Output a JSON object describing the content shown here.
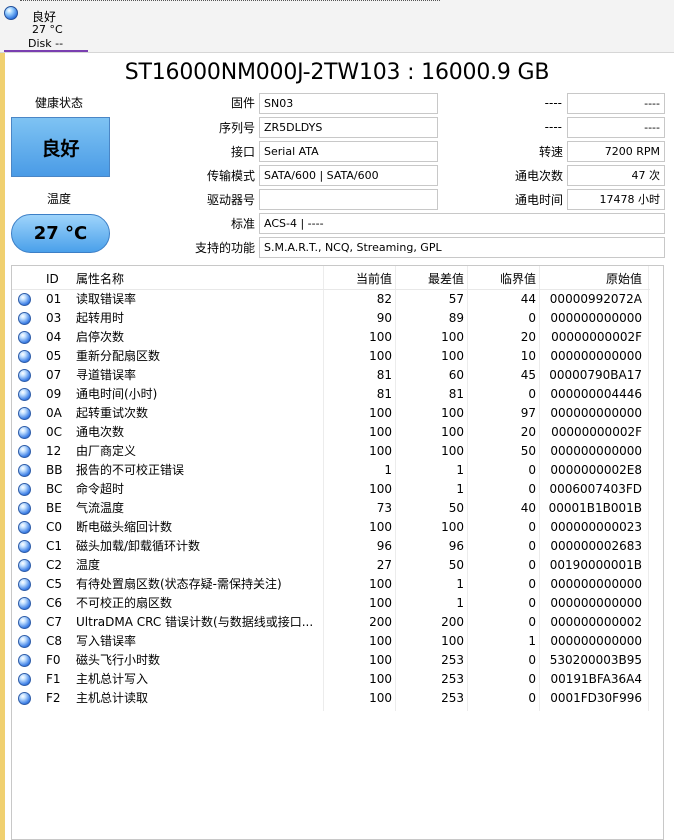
{
  "disk_tab": {
    "status": "良好",
    "temp": "27 °C",
    "disk": "Disk --"
  },
  "title": "ST16000NM000J-2TW103 : 16000.9 GB",
  "health": {
    "label": "健康状态",
    "value": "良好"
  },
  "temperature": {
    "label": "温度",
    "value": "27 °C"
  },
  "fields": {
    "firmware": {
      "label": "固件",
      "value": "SN03"
    },
    "serial": {
      "label": "序列号",
      "value": "ZR5DLDYS"
    },
    "interface": {
      "label": "接口",
      "value": "Serial ATA"
    },
    "transfer": {
      "label": "传输模式",
      "value": "SATA/600 | SATA/600"
    },
    "drive_letter": {
      "label": "驱动器号",
      "value": ""
    },
    "standard": {
      "label": "标准",
      "value": "ACS-4 | ----"
    },
    "features": {
      "label": "支持的功能",
      "value": "S.M.A.R.T., NCQ, Streaming, GPL"
    },
    "right1": {
      "label": "----",
      "value": "----"
    },
    "right2": {
      "label": "----",
      "value": "----"
    },
    "rotation": {
      "label": "转速",
      "value": "7200 RPM"
    },
    "power_count": {
      "label": "通电次数",
      "value": "47 次"
    },
    "power_hours": {
      "label": "通电时间",
      "value": "17478 小时"
    }
  },
  "table": {
    "headers": {
      "id": "ID",
      "name": "属性名称",
      "current": "当前值",
      "worst": "最差值",
      "threshold": "临界值",
      "raw": "原始值"
    },
    "rows": [
      {
        "id": "01",
        "name": "读取错误率",
        "current": "82",
        "worst": "57",
        "threshold": "44",
        "raw": "00000992072A"
      },
      {
        "id": "03",
        "name": "起转用时",
        "current": "90",
        "worst": "89",
        "threshold": "0",
        "raw": "000000000000"
      },
      {
        "id": "04",
        "name": "启停次数",
        "current": "100",
        "worst": "100",
        "threshold": "20",
        "raw": "00000000002F"
      },
      {
        "id": "05",
        "name": "重新分配扇区数",
        "current": "100",
        "worst": "100",
        "threshold": "10",
        "raw": "000000000000"
      },
      {
        "id": "07",
        "name": "寻道错误率",
        "current": "81",
        "worst": "60",
        "threshold": "45",
        "raw": "00000790BA17"
      },
      {
        "id": "09",
        "name": "通电时间(小时)",
        "current": "81",
        "worst": "81",
        "threshold": "0",
        "raw": "000000004446"
      },
      {
        "id": "0A",
        "name": "起转重试次数",
        "current": "100",
        "worst": "100",
        "threshold": "97",
        "raw": "000000000000"
      },
      {
        "id": "0C",
        "name": "通电次数",
        "current": "100",
        "worst": "100",
        "threshold": "20",
        "raw": "00000000002F"
      },
      {
        "id": "12",
        "name": "由厂商定义",
        "current": "100",
        "worst": "100",
        "threshold": "50",
        "raw": "000000000000"
      },
      {
        "id": "BB",
        "name": "报告的不可校正错误",
        "current": "1",
        "worst": "1",
        "threshold": "0",
        "raw": "0000000002E8"
      },
      {
        "id": "BC",
        "name": "命令超时",
        "current": "100",
        "worst": "1",
        "threshold": "0",
        "raw": "0006007403FD"
      },
      {
        "id": "BE",
        "name": "气流温度",
        "current": "73",
        "worst": "50",
        "threshold": "40",
        "raw": "00001B1B001B"
      },
      {
        "id": "C0",
        "name": "断电磁头缩回计数",
        "current": "100",
        "worst": "100",
        "threshold": "0",
        "raw": "000000000023"
      },
      {
        "id": "C1",
        "name": "磁头加载/卸载循环计数",
        "current": "96",
        "worst": "96",
        "threshold": "0",
        "raw": "000000002683"
      },
      {
        "id": "C2",
        "name": "温度",
        "current": "27",
        "worst": "50",
        "threshold": "0",
        "raw": "00190000001B"
      },
      {
        "id": "C5",
        "name": "有待处置扇区数(状态存疑-需保持关注)",
        "current": "100",
        "worst": "1",
        "threshold": "0",
        "raw": "000000000000"
      },
      {
        "id": "C6",
        "name": "不可校正的扇区数",
        "current": "100",
        "worst": "1",
        "threshold": "0",
        "raw": "000000000000"
      },
      {
        "id": "C7",
        "name": "UltraDMA CRC 错误计数(与数据线或接口...",
        "current": "200",
        "worst": "200",
        "threshold": "0",
        "raw": "000000000002"
      },
      {
        "id": "C8",
        "name": "写入错误率",
        "current": "100",
        "worst": "100",
        "threshold": "1",
        "raw": "000000000000"
      },
      {
        "id": "F0",
        "name": "磁头飞行小时数",
        "current": "100",
        "worst": "253",
        "threshold": "0",
        "raw": "530200003B95"
      },
      {
        "id": "F1",
        "name": "主机总计写入",
        "current": "100",
        "worst": "253",
        "threshold": "0",
        "raw": "00191BFA36A4"
      },
      {
        "id": "F2",
        "name": "主机总计读取",
        "current": "100",
        "worst": "253",
        "threshold": "0",
        "raw": "0001FD30F996"
      }
    ]
  }
}
